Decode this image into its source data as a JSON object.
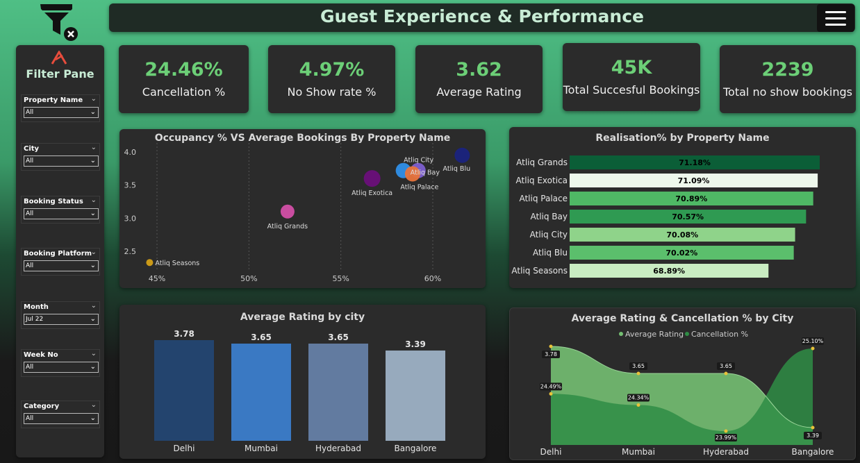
{
  "header": {
    "title": "Guest Experience & Performance"
  },
  "icons": {
    "filter": "filter-clear-icon",
    "menu": "hamburger-menu-icon",
    "logo": "atliq-logo-icon"
  },
  "filter_pane": {
    "title": "Filter Pane",
    "slicers": [
      {
        "label": "Property Name",
        "value": "All"
      },
      {
        "label": "City",
        "value": "All"
      },
      {
        "label": "Booking Status",
        "value": "All"
      },
      {
        "label": "Booking Platform",
        "value": "All"
      },
      {
        "label": "Month",
        "value": "Jul 22"
      },
      {
        "label": "Week No",
        "value": "All"
      },
      {
        "label": "Category",
        "value": "All"
      }
    ]
  },
  "kpis": [
    {
      "value": "24.46%",
      "label": "Cancellation %"
    },
    {
      "value": "4.97%",
      "label": "No Show rate %"
    },
    {
      "value": "3.62",
      "label": "Average Rating"
    },
    {
      "value": "45K",
      "label": "Total Succesful Bookings"
    },
    {
      "value": "2239",
      "label": "Total no show bookings"
    }
  ],
  "colors": {
    "accent_green": "#6ccf77",
    "bg_panel": "#2b2b2b"
  },
  "chart_data": [
    {
      "type": "scatter",
      "title": "Occupancy % VS Average Bookings By Property Name",
      "xlabel": "",
      "ylabel": "",
      "xlim": [
        44.5,
        62
      ],
      "ylim": [
        2.3,
        4.1
      ],
      "x_ticks": [
        "45%",
        "50%",
        "55%",
        "60%"
      ],
      "y_ticks": [
        "4.0",
        "3.5",
        "3.0",
        "2.5"
      ],
      "points": [
        {
          "name": "Atliq Seasons",
          "x": 44.6,
          "y": 2.33,
          "size": 5,
          "color": "#d4a017"
        },
        {
          "name": "Atliq Grands",
          "x": 52.1,
          "y": 3.1,
          "size": 10,
          "color": "#d24fa6"
        },
        {
          "name": "Atliq Exotica",
          "x": 56.7,
          "y": 3.6,
          "size": 12,
          "color": "#6a0f7a"
        },
        {
          "name": "Atliq City",
          "x": 58.4,
          "y": 3.72,
          "size": 11,
          "color": "#2f8fe8"
        },
        {
          "name": "Atliq Bay",
          "x": 59.2,
          "y": 3.72,
          "size": 11,
          "color": "#7d5fd0"
        },
        {
          "name": "Atliq Palace",
          "x": 58.9,
          "y": 3.67,
          "size": 11,
          "color": "#e8743b"
        },
        {
          "name": "Atliq Blu",
          "x": 61.6,
          "y": 3.95,
          "size": 11,
          "color": "#1a237e"
        }
      ]
    },
    {
      "type": "bar",
      "title": "Realisation% by Property Name",
      "orientation": "horizontal",
      "categories": [
        "Atliq Grands",
        "Atliq Exotica",
        "Atliq Palace",
        "Atliq Bay",
        "Atliq City",
        "Atliq Blu",
        "Atliq Seasons"
      ],
      "values": [
        71.18,
        71.09,
        70.89,
        70.57,
        70.08,
        70.02,
        68.89
      ],
      "labels": [
        "71.18%",
        "71.09%",
        "70.89%",
        "70.57%",
        "70.08%",
        "70.02%",
        "68.89%"
      ],
      "colors": [
        "#0b5e37",
        "#eef8ec",
        "#4fb865",
        "#2f9a52",
        "#8fd38a",
        "#5bbf6c",
        "#c9ecc2"
      ]
    },
    {
      "type": "bar",
      "title": "Average Rating by city",
      "categories": [
        "Delhi",
        "Mumbai",
        "Hyderabad",
        "Bangalore"
      ],
      "values": [
        3.78,
        3.65,
        3.65,
        3.39
      ],
      "labels": [
        "3.78",
        "3.65",
        "3.65",
        "3.39"
      ],
      "colors": [
        "#23446e",
        "#3a79c3",
        "#627ba0",
        "#97aabd"
      ],
      "ylim": [
        0,
        4.2
      ]
    },
    {
      "type": "area",
      "title": "Average Rating & Cancellation % by City",
      "categories": [
        "Delhi",
        "Mumbai",
        "Hyderabad",
        "Bangalore"
      ],
      "series": [
        {
          "name": "Average Rating",
          "values": [
            3.78,
            3.65,
            3.65,
            3.39
          ],
          "labels": [
            "3.78",
            "3.65",
            "3.65",
            "3.39"
          ],
          "color": "#74bf72"
        },
        {
          "name": "Cancellation %",
          "values": [
            24.49,
            24.34,
            23.99,
            25.1
          ],
          "labels": [
            "24.49%",
            "24.34%",
            "23.99%",
            "25.10%"
          ],
          "color": "#2f8d45"
        }
      ]
    }
  ]
}
